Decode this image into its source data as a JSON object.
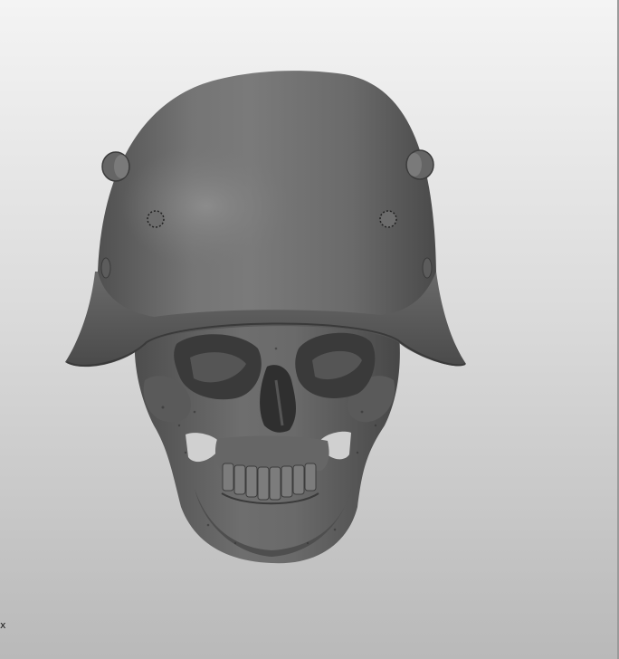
{
  "viewport": {
    "axis_label": "x",
    "model": "skull-with-helmet"
  },
  "colors": {
    "background_top": "#f4f4f4",
    "background_bottom": "#b9b9b9",
    "model_base": "#6b6b6b",
    "model_shadow": "#3e3e3e",
    "model_highlight": "#8c8c8c"
  }
}
